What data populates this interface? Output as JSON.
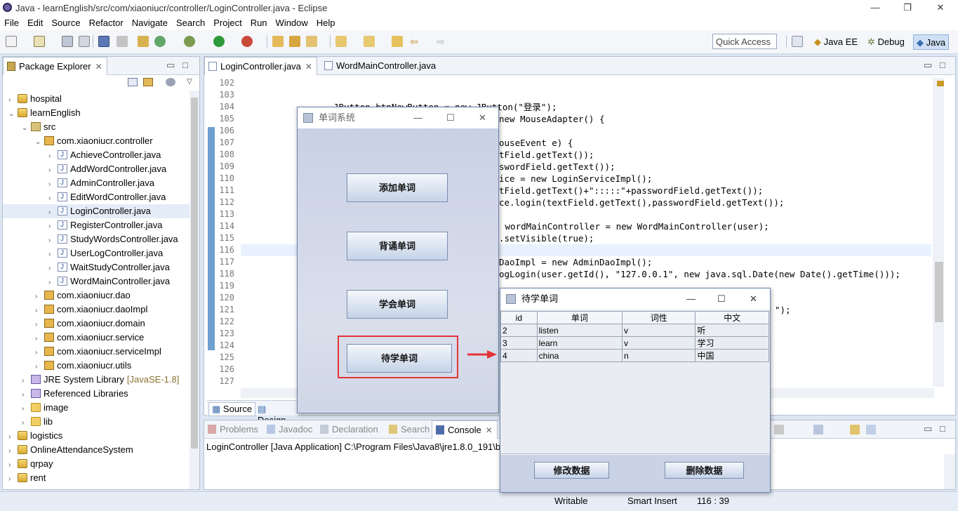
{
  "window": {
    "title": "Java - learnEnglish/src/com/xiaoniucr/controller/LoginController.java - Eclipse"
  },
  "menu": [
    "File",
    "Edit",
    "Source",
    "Refactor",
    "Navigate",
    "Search",
    "Project",
    "Run",
    "Window",
    "Help"
  ],
  "toolbar": {
    "quick_access": "Quick Access",
    "perspectives": [
      "Java EE",
      "Debug",
      "Java"
    ]
  },
  "package_explorer": {
    "tab": "Package Explorer",
    "items": [
      {
        "label": "hospital",
        "level": 0,
        "icon": "project",
        "tw": "›"
      },
      {
        "label": "learnEnglish",
        "level": 0,
        "icon": "project",
        "tw": "⌄"
      },
      {
        "label": "src",
        "level": 1,
        "icon": "src",
        "tw": "⌄"
      },
      {
        "label": "com.xiaoniucr.controller",
        "level": 2,
        "icon": "package",
        "tw": "⌄"
      },
      {
        "label": "AchieveController.java",
        "level": 3,
        "icon": "java",
        "tw": "›"
      },
      {
        "label": "AddWordController.java",
        "level": 3,
        "icon": "java",
        "tw": "›"
      },
      {
        "label": "AdminController.java",
        "level": 3,
        "icon": "java",
        "tw": "›"
      },
      {
        "label": "EditWordController.java",
        "level": 3,
        "icon": "java",
        "tw": "›"
      },
      {
        "label": "LoginController.java",
        "level": 3,
        "icon": "java",
        "tw": "›",
        "selected": true
      },
      {
        "label": "RegisterController.java",
        "level": 3,
        "icon": "java",
        "tw": "›"
      },
      {
        "label": "StudyWordsController.java",
        "level": 3,
        "icon": "java",
        "tw": "›"
      },
      {
        "label": "UserLogController.java",
        "level": 3,
        "icon": "java",
        "tw": "›"
      },
      {
        "label": "WaitStudyController.java",
        "level": 3,
        "icon": "java",
        "tw": "›"
      },
      {
        "label": "WordMainController.java",
        "level": 3,
        "icon": "java",
        "tw": "›"
      },
      {
        "label": "com.xiaoniucr.dao",
        "level": 2,
        "icon": "package",
        "tw": "›"
      },
      {
        "label": "com.xiaoniucr.daoImpl",
        "level": 2,
        "icon": "package",
        "tw": "›"
      },
      {
        "label": "com.xiaoniucr.domain",
        "level": 2,
        "icon": "package",
        "tw": "›"
      },
      {
        "label": "com.xiaoniucr.service",
        "level": 2,
        "icon": "package",
        "tw": "›"
      },
      {
        "label": "com.xiaoniucr.serviceImpl",
        "level": 2,
        "icon": "package",
        "tw": "›"
      },
      {
        "label": "com.xiaoniucr.utils",
        "level": 2,
        "icon": "package",
        "tw": "›"
      },
      {
        "label": "JRE System Library",
        "suffix": "[JavaSE-1.8]",
        "level": 1,
        "icon": "lib",
        "tw": "›"
      },
      {
        "label": "Referenced Libraries",
        "level": 1,
        "icon": "lib",
        "tw": "›"
      },
      {
        "label": "image",
        "level": 1,
        "icon": "folder",
        "tw": "›"
      },
      {
        "label": "lib",
        "level": 1,
        "icon": "folder",
        "tw": "›"
      },
      {
        "label": "logistics",
        "level": 0,
        "icon": "project",
        "tw": "›"
      },
      {
        "label": "OnlineAttendanceSystem",
        "level": 0,
        "icon": "project",
        "tw": "›"
      },
      {
        "label": "qrpay",
        "level": 0,
        "icon": "project",
        "tw": "›"
      },
      {
        "label": "rent",
        "level": 0,
        "icon": "project",
        "tw": "›"
      }
    ]
  },
  "editor": {
    "tabs": [
      "LoginController.java",
      "WordMainController.java"
    ],
    "line_numbers": [
      "102",
      "103",
      "104",
      "105",
      "106",
      "107",
      "108",
      "109",
      "110",
      "111",
      "112",
      "113",
      "114",
      "115",
      "116",
      "117",
      "118",
      "119",
      "120",
      "121",
      "122",
      "123",
      "124",
      "125",
      "126",
      "127"
    ],
    "lines": [
      {
        "n": "104",
        "t": "JButton btnNewButton = new JButton(\"登录\");"
      },
      {
        "n": "105",
        "t": "new MouseAdapter() {"
      },
      {
        "n": "107",
        "t": "ouseEvent e) {"
      },
      {
        "n": "108",
        "t": "tField.getText());"
      },
      {
        "n": "109",
        "t": "swordField.getText());"
      },
      {
        "n": "110",
        "t": "ice = new LoginServiceImpl();"
      },
      {
        "n": "111",
        "t": "tField.getText()+\":::::\"+passwordField.getText());"
      },
      {
        "n": "112",
        "t": "ce.login(textField.getText(),passwordField.getText());"
      },
      {
        "n": "114",
        "t": " wordMainController = new WordMainController(user);"
      },
      {
        "n": "115",
        "t": ".setVisible(true);"
      },
      {
        "n": "117",
        "t": "DaoImpl = new AdminDaoImpl();"
      },
      {
        "n": "118",
        "t": "ogLogin(user.getId(), \"127.0.0.1\", new java.sql.Date(new Date().getTime()));"
      },
      {
        "n": "121",
        "t": "\");"
      }
    ],
    "bottom_tabs": [
      "Source",
      "Design"
    ]
  },
  "bottom_panel": {
    "tabs": [
      "Problems",
      "Javadoc",
      "Declaration",
      "Search",
      "Console"
    ],
    "console_line": "LoginController [Java Application] C:\\Program Files\\Java8\\jre1.8.0_191\\b"
  },
  "status": {
    "mode": "Writable",
    "insert": "Smart Insert",
    "position": "116 : 39"
  },
  "main_dialog": {
    "title": "单词系统",
    "buttons": [
      "添加单词",
      "背诵单词",
      "学会单词",
      "待学单词"
    ]
  },
  "wait_dialog": {
    "title": "待学单词",
    "columns": [
      "id",
      "单词",
      "词性",
      "中文"
    ],
    "rows": [
      [
        "2",
        "listen",
        "v",
        "听"
      ],
      [
        "3",
        "learn",
        "v",
        "学习"
      ],
      [
        "4",
        "china",
        "n",
        "中国"
      ]
    ],
    "buttons": [
      "修改数据",
      "删除数据"
    ]
  },
  "colors": {
    "highlight": "#e5333a",
    "accent": "#3b6bb0"
  }
}
